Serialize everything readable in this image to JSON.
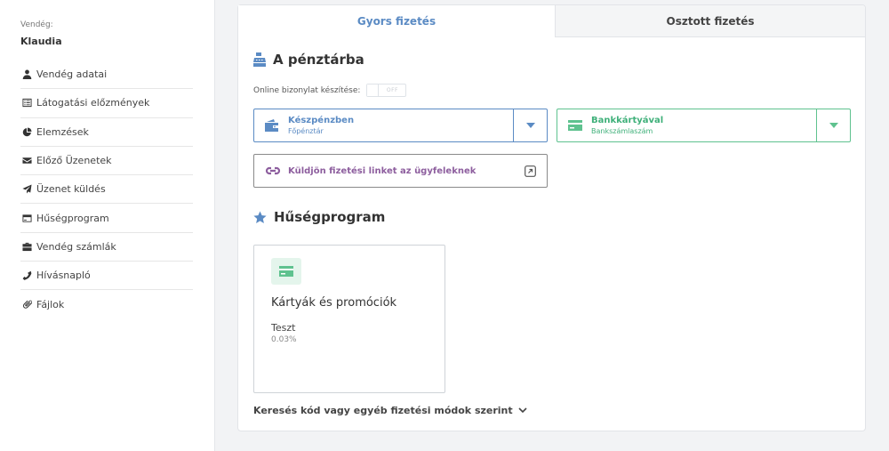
{
  "sidebar": {
    "guest_label": "Vendég:",
    "guest_name": "Klaudia",
    "items": [
      {
        "label": "Vendég adatai",
        "icon": "user-icon"
      },
      {
        "label": "Látogatási előzmények",
        "icon": "list-icon"
      },
      {
        "label": "Elemzések",
        "icon": "pie-chart-icon"
      },
      {
        "label": "Előző Üzenetek",
        "icon": "envelope-icon"
      },
      {
        "label": "Üzenet küldés",
        "icon": "paper-plane-icon"
      },
      {
        "label": "Hűségprogram",
        "icon": "credit-card-icon"
      },
      {
        "label": "Vendég számlák",
        "icon": "briefcase-icon"
      },
      {
        "label": "Hívásnapló",
        "icon": "phone-icon"
      },
      {
        "label": "Fájlok",
        "icon": "paperclip-icon"
      }
    ]
  },
  "tabs": {
    "gyors": "Gyors fizetés",
    "osztott": "Osztott fizetés"
  },
  "checkout": {
    "title": "A pénztárba",
    "online_receipt_label": "Online bizonylat készítése:",
    "toggle_state": "OFF",
    "cash": {
      "title": "Készpénzben",
      "subtitle": "Főpénztár"
    },
    "card": {
      "title": "Bankkártyával",
      "subtitle": "Bankszámlaszám"
    },
    "payment_link": "Küldjön fizetési linket az ügyfeleknek"
  },
  "loyalty": {
    "title": "Hűségprogram",
    "card_title": "Kártyák és promóciók",
    "program_name": "Teszt",
    "program_value": "0.03%"
  },
  "search_more": "Keresés kód vagy egyéb fizetési módok szerint",
  "colors": {
    "primary_blue": "#5b8bc4",
    "green": "#5fc28f",
    "purple": "#8d5e9e"
  }
}
